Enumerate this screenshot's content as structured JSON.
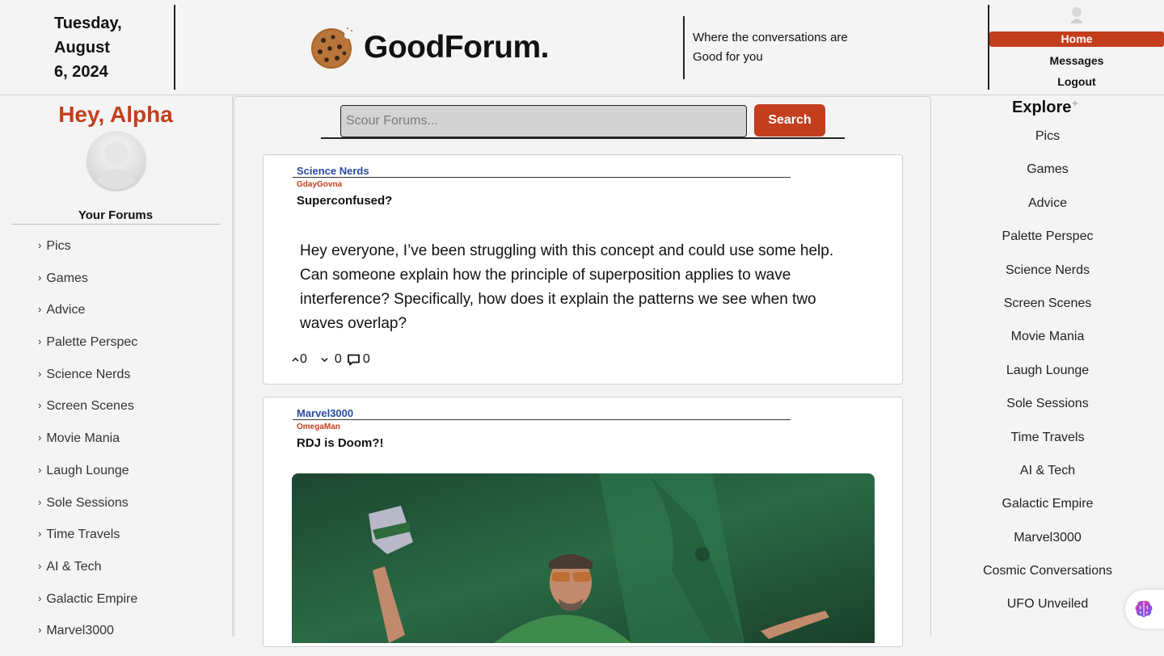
{
  "header": {
    "date_line1": "Tuesday,",
    "date_line2": "August",
    "date_line3": "6, 2024",
    "brand": "GoodForum.",
    "tagline_line1": "Where the conversations are",
    "tagline_line2": "Good for you",
    "nav": [
      "Home",
      "Messages",
      "Logout"
    ]
  },
  "left": {
    "greeting": "Hey, Alpha",
    "your_forums_label": "Your Forums",
    "forums": [
      "Pics",
      "Games",
      "Advice",
      "Palette Perspec",
      "Science Nerds",
      "Screen Scenes",
      "Movie Mania",
      "Laugh Lounge",
      "Sole Sessions",
      "Time Travels",
      "AI & Tech",
      "Galactic Empire",
      "Marvel3000"
    ]
  },
  "search": {
    "placeholder": "Scour Forums...",
    "button": "Search"
  },
  "posts": [
    {
      "forum": "Science Nerds",
      "author": "GdayGovna",
      "title": "Superconfused?",
      "body_line1": "Hey everyone, I’ve been struggling with this concept and could use some help.",
      "body_line2": "Can someone explain how the principle of superposition applies to wave",
      "body_line3": "interference? Specifically, how does it explain the patterns we see when two",
      "body_line4": "waves overlap?",
      "upvotes": "0",
      "downvotes": "0",
      "comments": "0"
    },
    {
      "forum": "Marvel3000",
      "author": "OmegaMan",
      "title": "RDJ is Doom?!"
    }
  ],
  "right": {
    "explore_label": "Explore",
    "forums": [
      "Pics",
      "Games",
      "Advice",
      "Palette Perspec",
      "Science Nerds",
      "Screen Scenes",
      "Movie Mania",
      "Laugh Lounge",
      "Sole Sessions",
      "Time Travels",
      "AI & Tech",
      "Galactic Empire",
      "Marvel3000",
      "Cosmic Conversations",
      "UFO Unveiled"
    ]
  },
  "colors": {
    "accent": "#c23e1d",
    "forum_link": "#2a4aa0",
    "background": "#f4f4f4"
  }
}
